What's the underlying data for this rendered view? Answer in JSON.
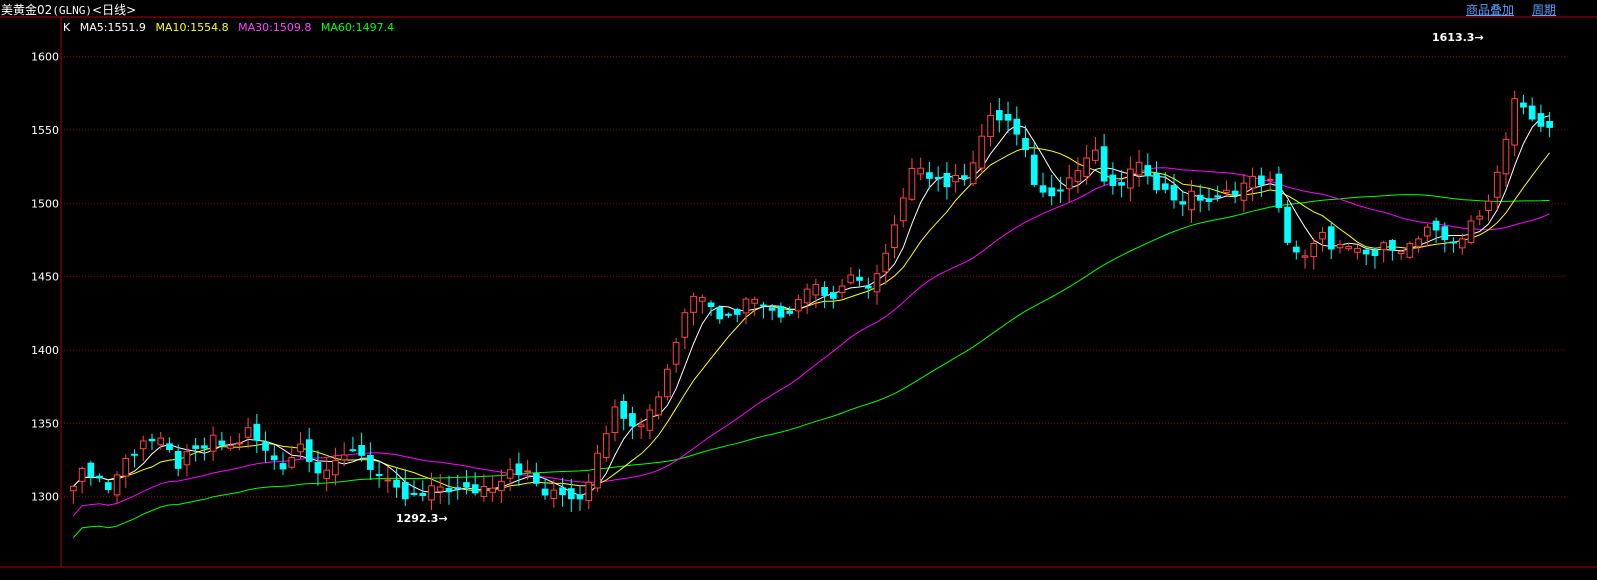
{
  "header": {
    "symbol": "美黄金02",
    "code": "(GLNG)",
    "period": "<日线>",
    "overlay_link": "商品叠加",
    "cycle_link": "周期"
  },
  "legend": {
    "k_label": "K",
    "ma5": "MA5:1551.9",
    "ma10": "MA10:1554.8",
    "ma30": "MA30:1509.8",
    "ma60": "MA60:1497.4"
  },
  "colors": {
    "up": "#ff4444",
    "down": "#00ffff",
    "ma5": "#ffffff",
    "ma10": "#ffff00",
    "ma30": "#ff00ff",
    "ma60": "#00ff00",
    "grid": "#8b0000",
    "axis": "#b00000"
  },
  "chart_data": {
    "type": "candlestick",
    "ylim": [
      1252,
      1627
    ],
    "yticks": [
      1300,
      1350,
      1400,
      1450,
      1500,
      1550,
      1600
    ],
    "grid": "horizontal dotted",
    "annotations": [
      {
        "label": "1613.3",
        "value": 1613.3,
        "note": "high"
      },
      {
        "label": "1292.3",
        "value": 1292.3,
        "note": "low"
      }
    ],
    "series": [
      {
        "name": "MA5",
        "value": 1551.9
      },
      {
        "name": "MA10",
        "value": 1554.8
      },
      {
        "name": "MA30",
        "value": 1509.8
      },
      {
        "name": "MA60",
        "value": 1497.4
      }
    ],
    "keypoints": [
      1312,
      1318,
      1306,
      1325,
      1340,
      1335,
      1322,
      1330,
      1338,
      1333,
      1345,
      1329,
      1322,
      1337,
      1318,
      1320,
      1335,
      1320,
      1305,
      1298,
      1300,
      1308,
      1303,
      1305,
      1310,
      1322,
      1313,
      1300,
      1302,
      1300,
      1340,
      1362,
      1350,
      1360,
      1395,
      1435,
      1440,
      1420,
      1430,
      1440,
      1420,
      1432,
      1450,
      1433,
      1448,
      1443,
      1455,
      1493,
      1530,
      1518,
      1512,
      1525,
      1555,
      1560,
      1538,
      1505,
      1512,
      1520,
      1537,
      1505,
      1520,
      1525,
      1508,
      1502,
      1505,
      1500,
      1510,
      1515,
      1517,
      1478,
      1460,
      1477,
      1470,
      1465,
      1464,
      1473,
      1470,
      1480,
      1475,
      1477,
      1490,
      1520,
      1572,
      1555,
      1550
    ],
    "ohlc_count": 170
  }
}
